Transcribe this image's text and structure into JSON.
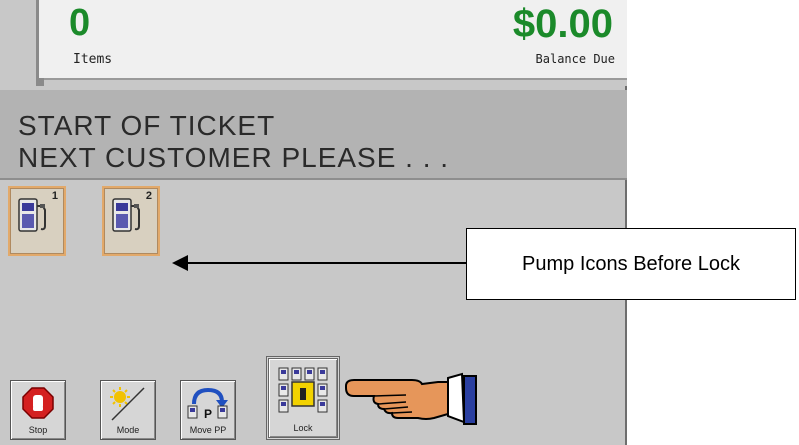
{
  "header": {
    "item_count": "0",
    "item_count_label": "Items",
    "balance_value": "$0.00",
    "balance_label": "Balance Due"
  },
  "message": {
    "line1": "START OF TICKET",
    "line2": "NEXT CUSTOMER PLEASE . . ."
  },
  "pumps": [
    {
      "number": "1",
      "icon": "fuel-pump-icon"
    },
    {
      "number": "2",
      "icon": "fuel-pump-icon"
    }
  ],
  "function_buttons": {
    "stop": {
      "label": "Stop",
      "icon": "stop-sign-icon"
    },
    "mode": {
      "label": "Mode",
      "icon": "day-night-icon"
    },
    "move": {
      "label": "Move PP",
      "icon": "move-prepay-icon"
    },
    "lock": {
      "label": "Lock",
      "icon": "lock-pumps-icon"
    }
  },
  "annotation": {
    "callout_text": "Pump Icons Before Lock",
    "pointer_icon": "pointing-hand-icon"
  },
  "colors": {
    "amount_green": "#1b8a2a",
    "panel_gray": "#c8c8c8",
    "pump_border": "#e2a96a"
  }
}
